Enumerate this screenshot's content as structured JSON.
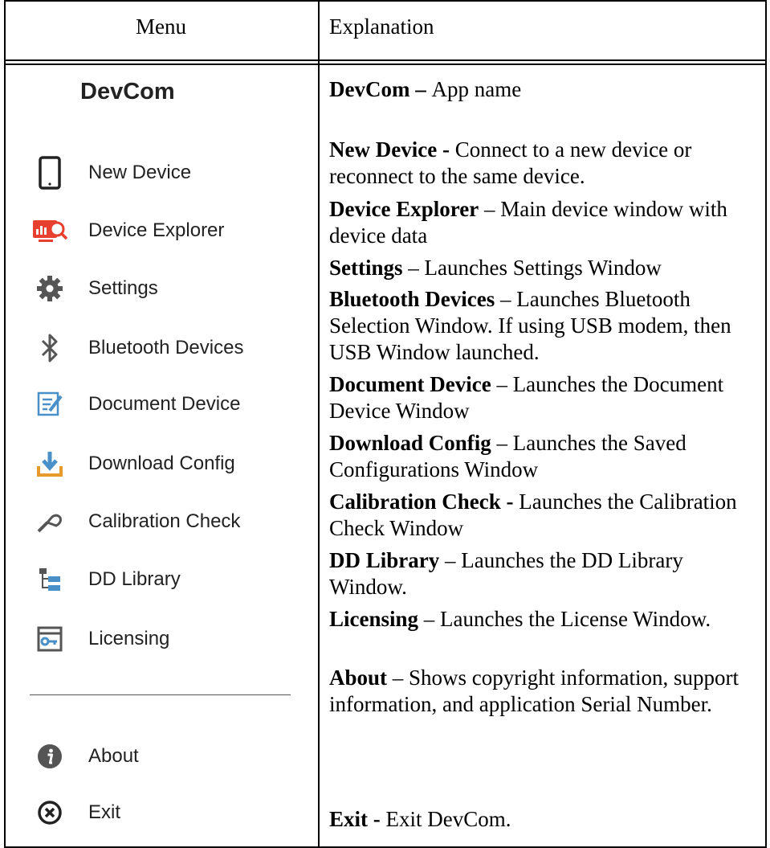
{
  "table": {
    "header_menu": "Menu",
    "header_explanation": "Explanation"
  },
  "menu": {
    "app_title": "DevCom",
    "items": [
      {
        "label": "New Device",
        "icon": "tablet-icon"
      },
      {
        "label": "Device Explorer",
        "icon": "monitor-search-icon"
      },
      {
        "label": "Settings",
        "icon": "gear-icon"
      },
      {
        "label": "Bluetooth Devices",
        "icon": "bluetooth-icon"
      },
      {
        "label": "Document Device",
        "icon": "edit-document-icon"
      },
      {
        "label": "Download Config",
        "icon": "download-icon"
      },
      {
        "label": "Calibration Check",
        "icon": "calibration-probe-icon"
      },
      {
        "label": "DD Library",
        "icon": "tree-folder-icon"
      },
      {
        "label": "Licensing",
        "icon": "license-key-icon"
      },
      {
        "label": "About",
        "icon": "info-icon"
      },
      {
        "label": "Exit",
        "icon": "close-circle-icon"
      }
    ],
    "colors": {
      "text": "#222222",
      "accent_red": "#e8402f",
      "icon_gray": "#555555",
      "icon_blue": "#4a90c8"
    }
  },
  "explanations": [
    {
      "term": "DevCom",
      "sep": " – ",
      "text": "App name"
    },
    {
      "term": "New Device",
      "sep": " - ",
      "text": "Connect to a new device or reconnect to the same device."
    },
    {
      "term": "Device Explorer",
      "sep": " – ",
      "text": "Main device window with device data"
    },
    {
      "term": "Settings",
      "sep": " – ",
      "text": "Launches Settings Window"
    },
    {
      "term": "Bluetooth Devices",
      "sep": " – ",
      "text": "Launches Bluetooth Selection Window.  If using USB modem, then USB Window launched."
    },
    {
      "term": "Document Device",
      "sep": " – ",
      "text": "Launches the Document Device Window"
    },
    {
      "term": "Download Config",
      "sep": " – ",
      "text": "Launches the Saved Configurations Window"
    },
    {
      "term": "Calibration Check",
      "sep": " - ",
      "text": "Launches the Calibration Check Window"
    },
    {
      "term": "DD Library",
      "sep": " – ",
      "text": "Launches the DD Library Window."
    },
    {
      "term": "Licensing",
      "sep": " – ",
      "text": "Launches the License Window."
    },
    {
      "term": "About",
      "sep": " – ",
      "text": "Shows copyright information, support information, and application Serial Number."
    },
    {
      "term": "Exit",
      "sep": " - ",
      "text": "Exit DevCom."
    }
  ]
}
